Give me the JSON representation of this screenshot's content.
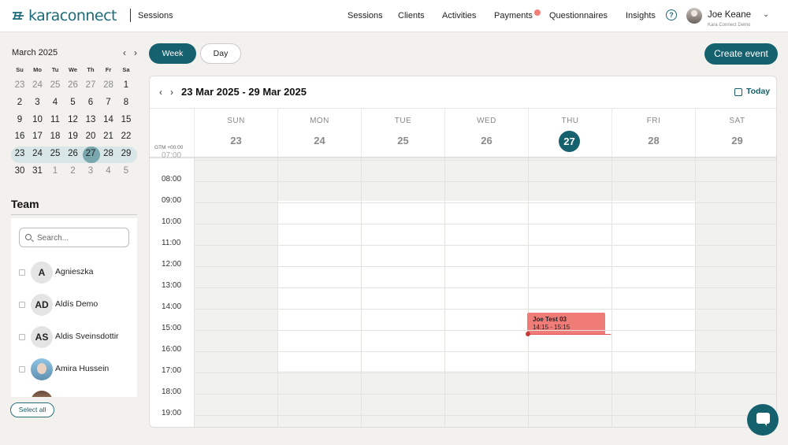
{
  "brand": {
    "logo_text": "karaconnect",
    "section": "Sessions"
  },
  "nav": {
    "items": [
      "Sessions",
      "Clients",
      "Activities",
      "Payments",
      "Questionnaires",
      "Insights"
    ],
    "help_label": "?",
    "user_name": "Joe Keane",
    "user_org": "Kara Connect Demo"
  },
  "mini_calendar": {
    "month_label": "March 2025",
    "weekdays": [
      "Su",
      "Mo",
      "Tu",
      "We",
      "Th",
      "Fr",
      "Sa"
    ],
    "weeks": [
      [
        "23",
        "24",
        "25",
        "26",
        "27",
        "28",
        "1"
      ],
      [
        "2",
        "3",
        "4",
        "5",
        "6",
        "7",
        "8"
      ],
      [
        "9",
        "10",
        "11",
        "12",
        "13",
        "14",
        "15"
      ],
      [
        "16",
        "17",
        "18",
        "19",
        "20",
        "21",
        "22"
      ],
      [
        "23",
        "24",
        "25",
        "26",
        "27",
        "28",
        "29"
      ],
      [
        "30",
        "31",
        "1",
        "2",
        "3",
        "4",
        "5"
      ]
    ],
    "selected_week_index": 4,
    "today": "27"
  },
  "team": {
    "title": "Team",
    "search_placeholder": "Search...",
    "members": [
      {
        "initials": "A",
        "name": "Agnieszka"
      },
      {
        "initials": "AD",
        "name": "Aldís Demo"
      },
      {
        "initials": "AS",
        "name": "Aldis Sveinsdottir"
      },
      {
        "initials": "",
        "name": "Amira Hussein"
      },
      {
        "initials": "",
        "name": ""
      }
    ],
    "select_all_label": "Select all"
  },
  "toolbar": {
    "week_label": "Week",
    "day_label": "Day",
    "create_label": "Create event"
  },
  "calendar": {
    "range_label": "23 Mar 2025 - 29 Mar 2025",
    "today_label": "Today",
    "timezone_label": "GTM +00:00",
    "days": [
      {
        "dow": "SUN",
        "num": "23"
      },
      {
        "dow": "MON",
        "num": "24"
      },
      {
        "dow": "TUE",
        "num": "25"
      },
      {
        "dow": "WED",
        "num": "26"
      },
      {
        "dow": "THU",
        "num": "27"
      },
      {
        "dow": "FRI",
        "num": "28"
      },
      {
        "dow": "SAT",
        "num": "29"
      }
    ],
    "hours": [
      "07:00",
      "08:00",
      "09:00",
      "10:00",
      "11:00",
      "12:00",
      "13:00",
      "14:00",
      "15:00",
      "16:00",
      "17:00",
      "18:00",
      "19:00"
    ],
    "event": {
      "title": "Joe Test 03",
      "time": "14:15 - 15:15",
      "day": "THU",
      "color": "#f07c78"
    }
  },
  "colors": {
    "accent": "#15616d",
    "event": "#f07c78",
    "off_hours": "#f1f1f0"
  }
}
